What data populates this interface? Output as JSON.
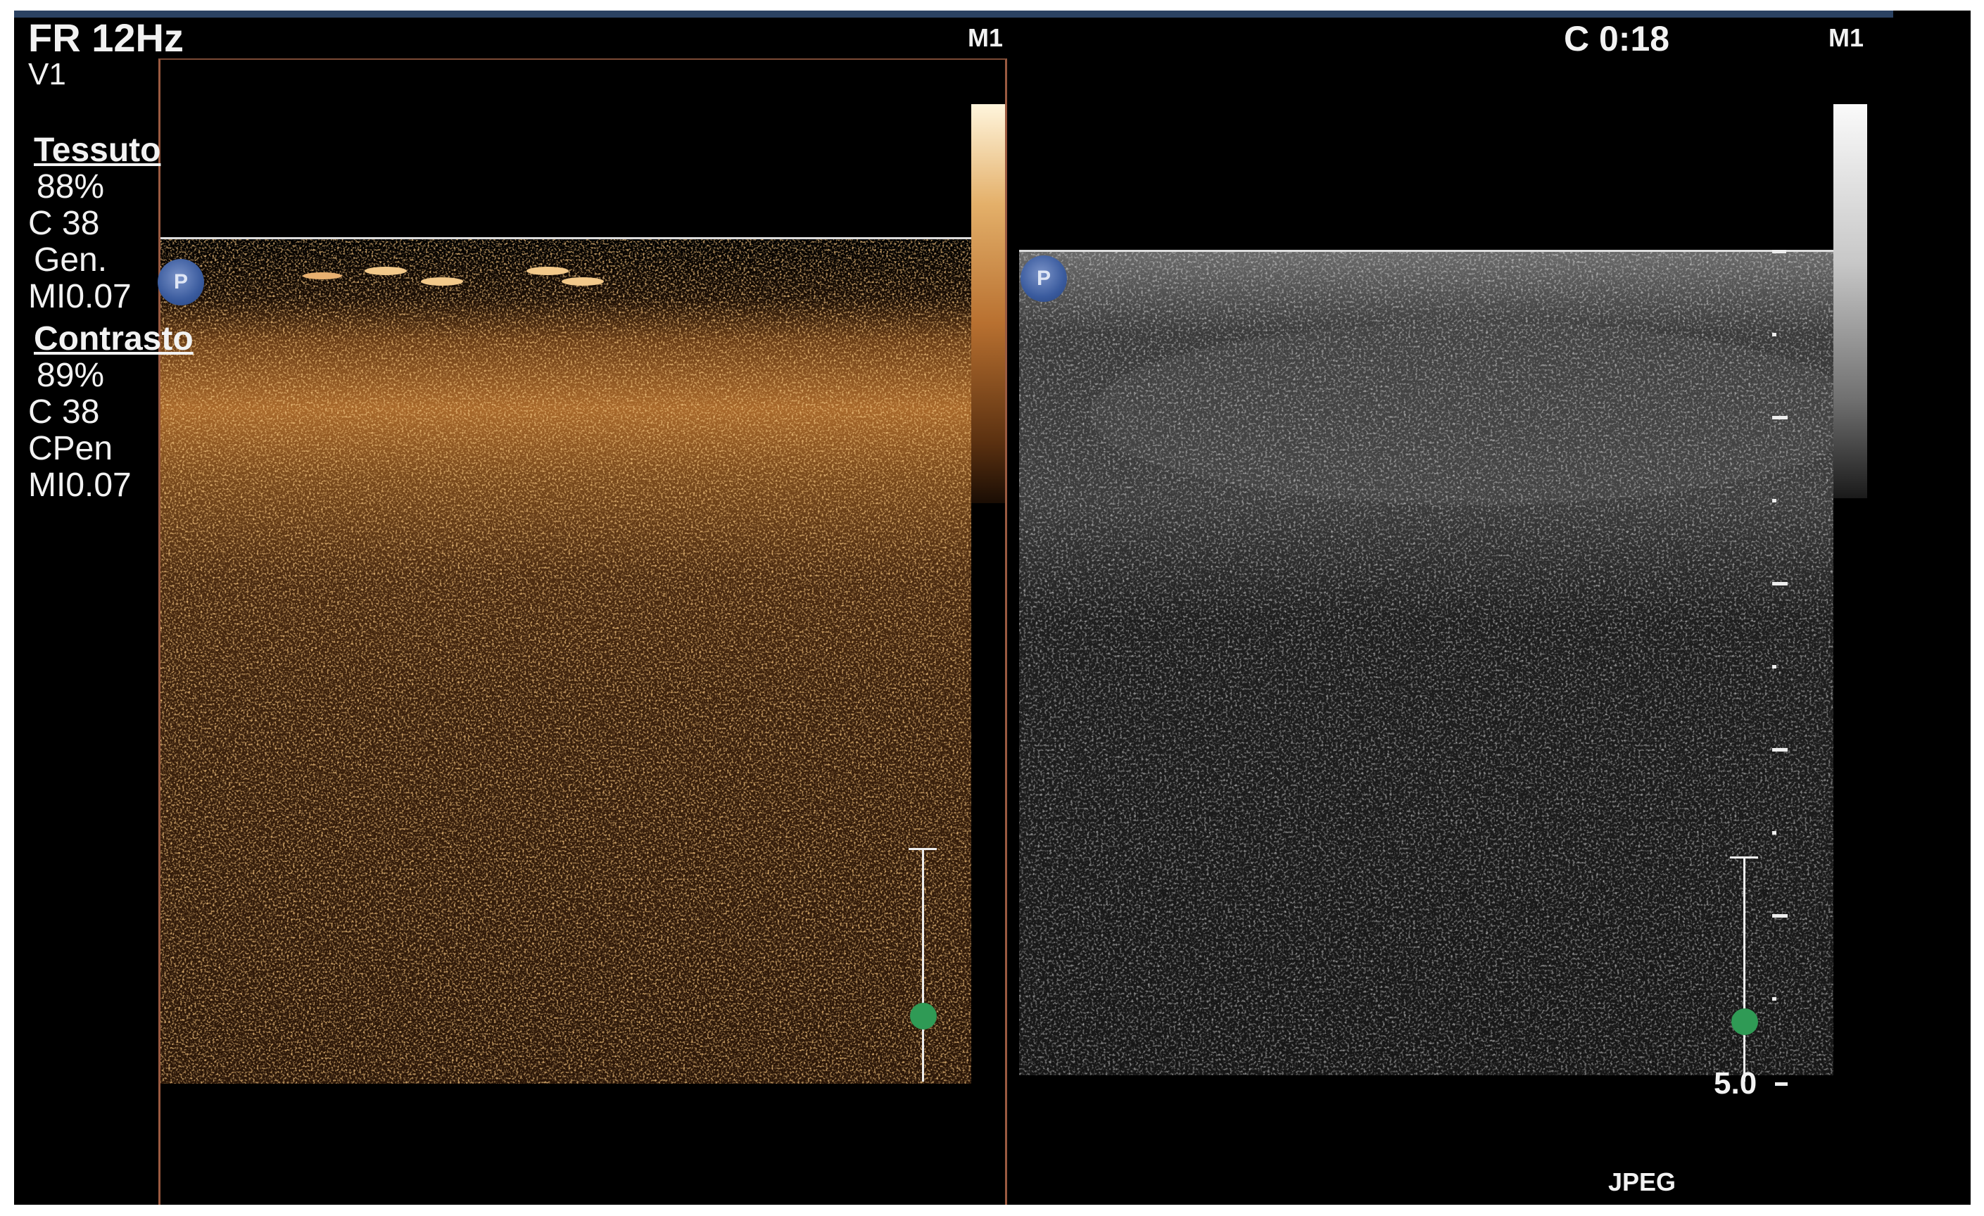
{
  "header": {
    "frame_rate": "FR 12Hz",
    "volume": "V1",
    "left_marker": "M1",
    "clip_time": "C 0:18",
    "right_marker": "M1"
  },
  "tissue": {
    "title": "Tessuto",
    "gain": "88%",
    "compression": "C 38",
    "mode": "Gen.",
    "mi": "MI0.07"
  },
  "contrast": {
    "title": "Contrasto",
    "gain": "89%",
    "compression": "C 38",
    "mode": "CPen",
    "mi": "MI0.07"
  },
  "probe_badge": "P",
  "depth_label": "5.0",
  "format_label": "JPEG",
  "colors": {
    "contrast_map": "#c8843a",
    "focus_marker": "#2f9a55",
    "topbar": "#2b4262"
  }
}
